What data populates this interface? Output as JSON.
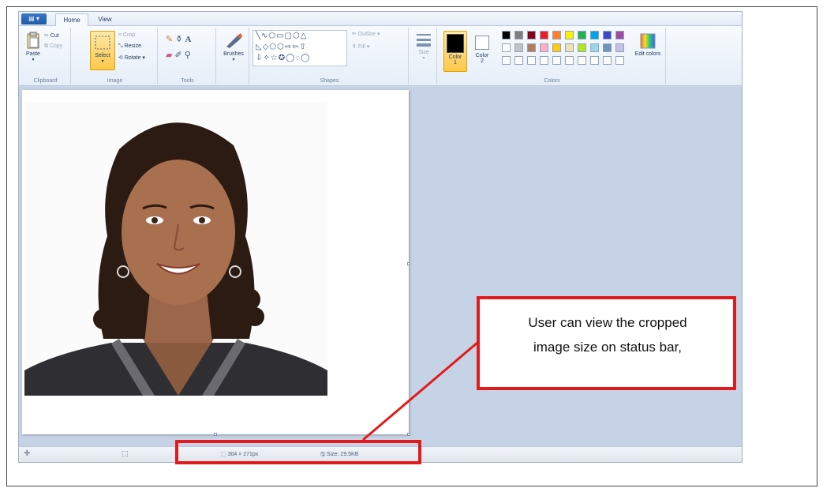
{
  "window": {
    "file_menu_label": "▤ ▾",
    "tabs": [
      {
        "label": "Home"
      },
      {
        "label": "View"
      }
    ]
  },
  "ribbon": {
    "clipboard": {
      "paste_label": "Paste",
      "cut_label": "Cut",
      "copy_label": "Copy",
      "group_label": "Clipboard"
    },
    "image": {
      "select_label": "Select",
      "crop_label": "Crop",
      "resize_label": "Resize",
      "rotate_label": "Rotate ▾",
      "group_label": "Image"
    },
    "tools": {
      "group_label": "Tools"
    },
    "brushes": {
      "label": "Brushes"
    },
    "shapes": {
      "outline_label": "Outline ▾",
      "fill_label": "Fill ▾",
      "group_label": "Shapes"
    },
    "size": {
      "label": "Size"
    },
    "colors": {
      "color1_label": "Color",
      "color1_num": "1",
      "color2_label": "Color",
      "color2_num": "2",
      "edit_colors_label": "Edit colors",
      "group_label": "Colors",
      "color1_value": "#000000",
      "color2_value": "#ffffff",
      "palette_row1": [
        "#000000",
        "#7f7f7f",
        "#880015",
        "#ed1c24",
        "#ff7f27",
        "#fff200",
        "#22b14c",
        "#00a2e8",
        "#3f48cc",
        "#a349a4"
      ],
      "palette_row2": [
        "#ffffff",
        "#c3c3c3",
        "#b97a57",
        "#ffaec9",
        "#ffc90e",
        "#efe4b0",
        "#b5e61d",
        "#99d9ea",
        "#7092be",
        "#c8bfe7"
      ],
      "palette_row3": [
        "#ffffff",
        "#ffffff",
        "#ffffff",
        "#ffffff",
        "#ffffff",
        "#ffffff",
        "#ffffff",
        "#ffffff",
        "#ffffff",
        "#ffffff"
      ]
    }
  },
  "statusbar": {
    "cursor_icon": "crosshair-icon",
    "selection_icon": "selection-icon",
    "dimensions": "304 × 271px",
    "size": "Size: 29.5KB"
  },
  "annotation": {
    "callout_line1": "User can view the cropped",
    "callout_line2": "image size on status bar,",
    "color": "#e11b1b"
  }
}
